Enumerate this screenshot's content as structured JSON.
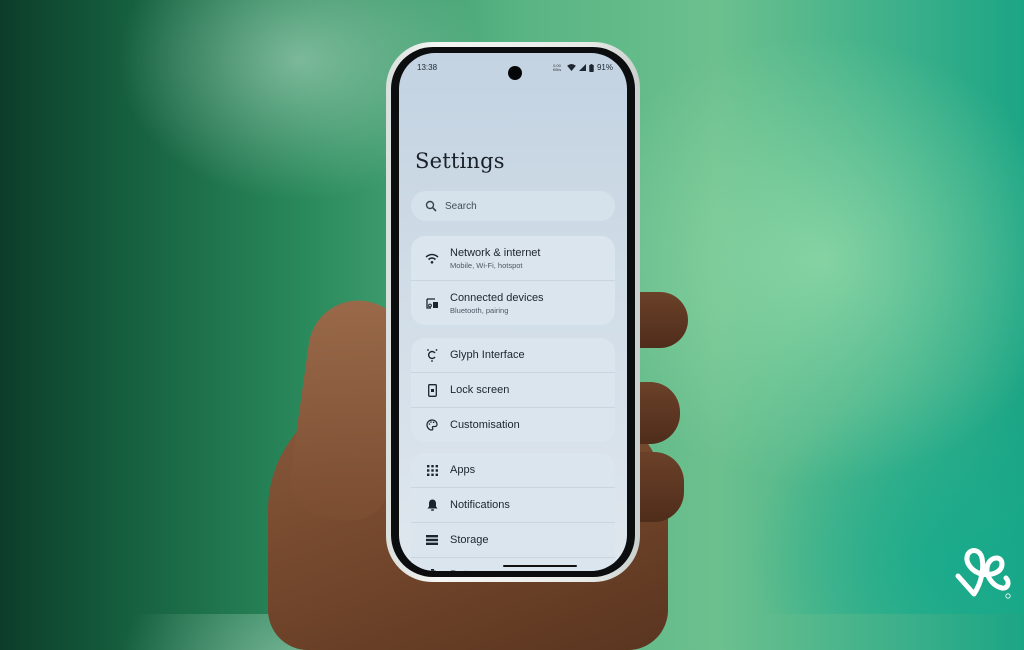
{
  "status_bar": {
    "time": "13:38",
    "net_speed": "0.00 KB/s",
    "battery": "91%",
    "icons": [
      "wifi-icon",
      "signal-icon",
      "battery-icon"
    ]
  },
  "settings": {
    "title": "Settings",
    "search": {
      "placeholder": "Search",
      "icon": "search-icon"
    },
    "groups": [
      [
        {
          "label": "Network & internet",
          "sub": "Mobile, Wi-Fi, hotspot",
          "icon": "wifi-icon"
        },
        {
          "label": "Connected devices",
          "sub": "Bluetooth, pairing",
          "icon": "connected-devices-icon"
        }
      ],
      [
        {
          "label": "Glyph Interface",
          "icon": "glyph-icon"
        },
        {
          "label": "Lock screen",
          "icon": "lock-screen-icon"
        },
        {
          "label": "Customisation",
          "icon": "palette-icon"
        }
      ],
      [
        {
          "label": "Apps",
          "icon": "apps-grid-icon"
        },
        {
          "label": "Notifications",
          "icon": "bell-icon"
        },
        {
          "label": "Storage",
          "icon": "storage-icon"
        },
        {
          "label": "Battery",
          "icon": "battery-icon"
        }
      ]
    ]
  },
  "watermark": {
    "icon": "brand-logo-icon"
  },
  "colors": {
    "background_accent": "#2a8a5c",
    "screen_bg": "#c3d3e2",
    "card_bg": "#dbe5ee"
  }
}
